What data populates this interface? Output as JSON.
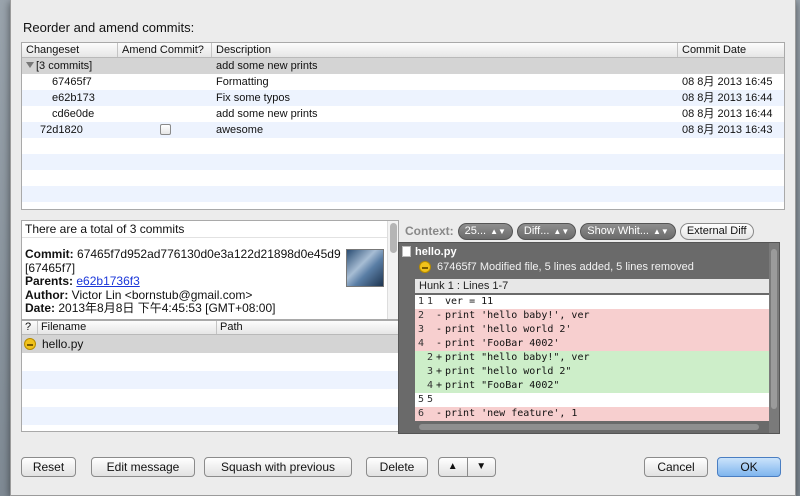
{
  "dialog": {
    "title": "Reorder and amend commits:"
  },
  "commit_table": {
    "columns": [
      "Changeset",
      "Amend Commit?",
      "Description",
      "Commit Date"
    ],
    "rows": [
      {
        "changeset": "[3 commits]",
        "description": "add some new prints",
        "date": ""
      },
      {
        "changeset": "67465f7",
        "description": "Formatting",
        "date": "08 8月 2013 16:45"
      },
      {
        "changeset": "e62b173",
        "description": "Fix some typos",
        "date": "08 8月 2013 16:44"
      },
      {
        "changeset": "cd6e0de",
        "description": "add some new prints",
        "date": "08 8月 2013 16:44"
      },
      {
        "changeset": "72d1820",
        "description": "awesome",
        "date": "08 8月 2013 16:43"
      }
    ]
  },
  "info": {
    "total": "There are a total of 3 commits",
    "commit_label": "Commit:",
    "commit_value": "67465f7d952ad776130d0e3a122d21898d0e45d9 [67465f7]",
    "parents_label": "Parents:",
    "parents_value": "e62b1736f3",
    "author_label": "Author:",
    "author_value": "Victor Lin <bornstub@gmail.com>",
    "date_label": "Date:",
    "date_value": "2013年8月8日 下午4:45:53 [GMT+08:00]"
  },
  "files": {
    "columns": [
      "?",
      "Filename",
      "Path"
    ],
    "rows": [
      {
        "filename": "hello.py",
        "path": ""
      }
    ]
  },
  "diff": {
    "context_label": "Context:",
    "context_value": "25...",
    "diff_button": "Diff...",
    "whitespace_button": "Show Whit...",
    "external_button": "External Diff",
    "file": "hello.py",
    "summary": "67465f7 Modified file, 5 lines added, 5 lines removed",
    "hunk": "Hunk 1 : Lines 1-7",
    "lines": [
      {
        "old": "1",
        "new": "1",
        "mark": " ",
        "text": "ver = 11",
        "kind": "ctx"
      },
      {
        "old": "2",
        "new": "",
        "mark": "-",
        "text": "print 'hello baby!', ver",
        "kind": "del"
      },
      {
        "old": "3",
        "new": "",
        "mark": "-",
        "text": "print 'hello world 2'",
        "kind": "del"
      },
      {
        "old": "4",
        "new": "",
        "mark": "-",
        "text": "print 'FooBar 4002'",
        "kind": "del"
      },
      {
        "old": "",
        "new": "2",
        "mark": "+",
        "text": "print \"hello baby!\", ver",
        "kind": "add"
      },
      {
        "old": "",
        "new": "3",
        "mark": "+",
        "text": "print \"hello world 2\"",
        "kind": "add"
      },
      {
        "old": "",
        "new": "4",
        "mark": "+",
        "text": "print \"FooBar 4002\"",
        "kind": "add"
      },
      {
        "old": "5",
        "new": "5",
        "mark": " ",
        "text": "",
        "kind": "ctx"
      },
      {
        "old": "6",
        "new": "",
        "mark": "-",
        "text": "print 'new feature', 1",
        "kind": "del"
      }
    ]
  },
  "buttons": {
    "reset": "Reset",
    "edit_message": "Edit message",
    "squash": "Squash with previous",
    "delete": "Delete",
    "up": "▲",
    "down": "▼",
    "cancel": "Cancel",
    "ok": "OK"
  }
}
